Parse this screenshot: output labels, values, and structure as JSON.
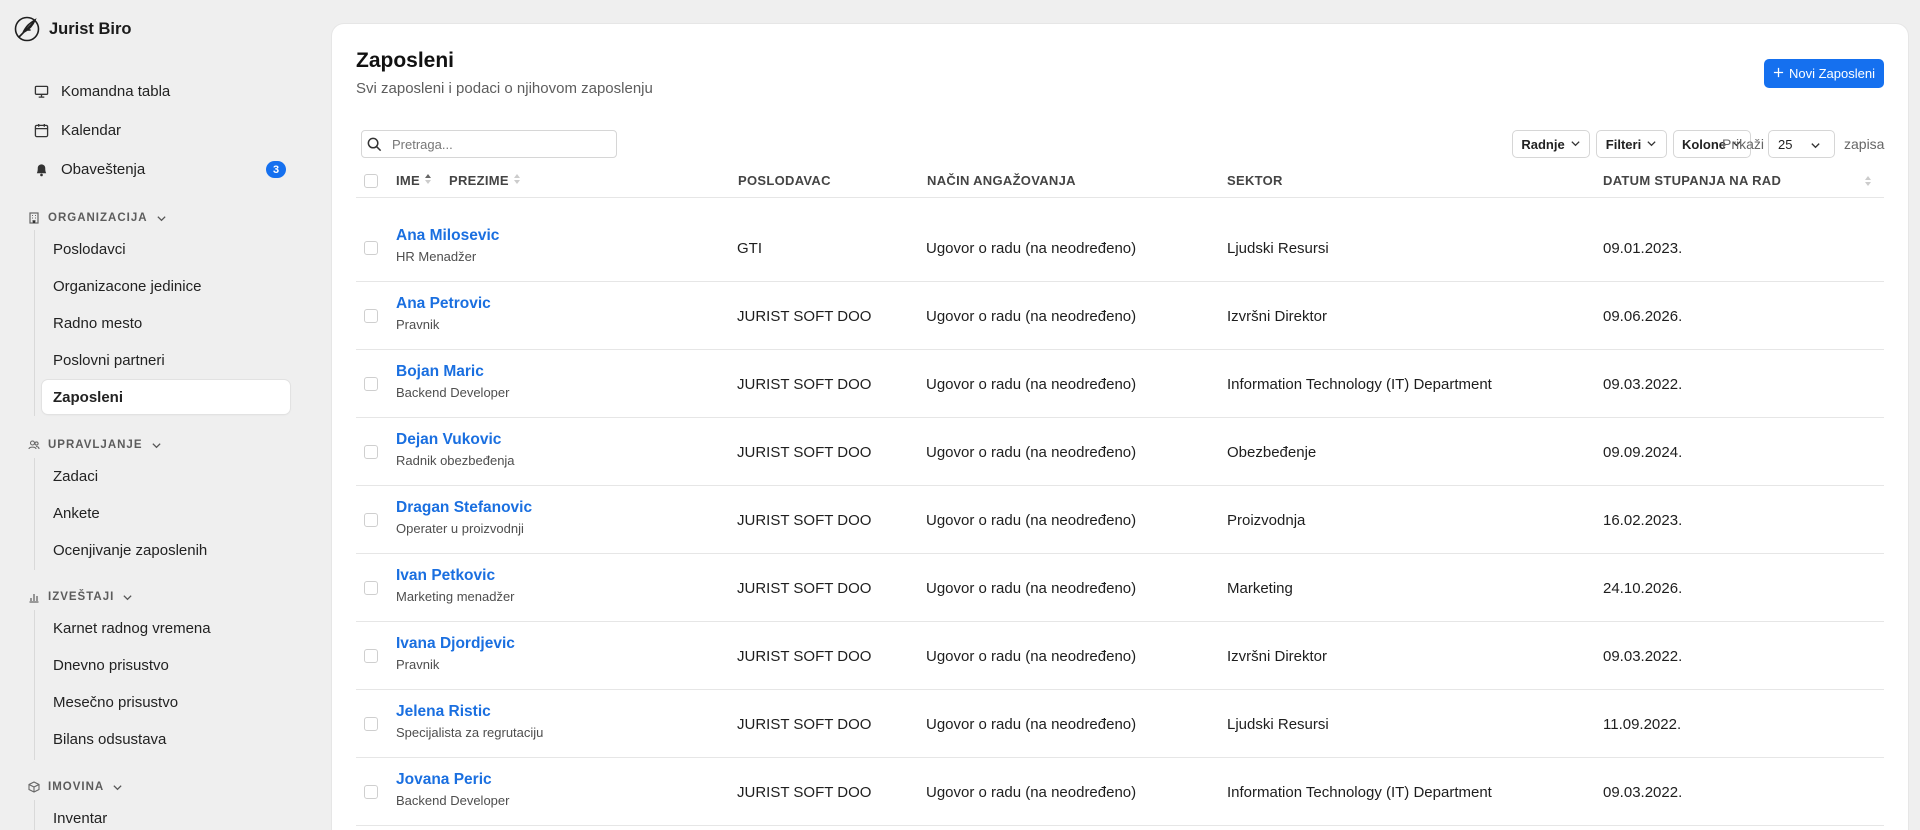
{
  "app": {
    "name": "Jurist Biro"
  },
  "nav": {
    "top_items": [
      {
        "label": "Komandna tabla",
        "icon": "monitor-icon"
      },
      {
        "label": "Kalendar",
        "icon": "calendar-icon"
      },
      {
        "label": "Obaveštenja",
        "icon": "bell-icon",
        "badge": "3"
      }
    ],
    "sections": [
      {
        "label": "ORGANIZACIJA",
        "icon": "building-icon",
        "items": [
          "Poslodavci",
          "Organizacone jedinice",
          "Radno mesto",
          "Poslovni partneri",
          "Zaposleni"
        ]
      },
      {
        "label": "UPRAVLJANJE",
        "icon": "users-icon",
        "items": [
          "Zadaci",
          "Ankete",
          "Ocenjivanje zaposlenih"
        ]
      },
      {
        "label": "IZVEŠTAJI",
        "icon": "bar-chart-icon",
        "items": [
          "Karnet radnog vremena",
          "Dnevno prisustvo",
          "Mesečno prisustvo",
          "Bilans odsustava"
        ]
      },
      {
        "label": "IMOVINA",
        "icon": "box-icon",
        "items": [
          "Inventar"
        ]
      }
    ],
    "active_item": "Zaposleni"
  },
  "page": {
    "title": "Zaposleni",
    "subtitle": "Svi zaposleni i podaci o njihovom zaposlenju",
    "new_button_label": "Novi Zaposleni"
  },
  "toolbar": {
    "search_placeholder": "Pretraga...",
    "actions_label": "Radnje",
    "filters_label": "Filteri",
    "columns_label": "Kolone",
    "show_label": "Prikaži",
    "page_size": "25",
    "records_label": "zapisa"
  },
  "table": {
    "columns": {
      "first_name": "IME",
      "last_name": "PREZIME",
      "employer": "POSLODAVAC",
      "engagement": "NAČIN ANGAŽOVANJA",
      "sector": "SEKTOR",
      "start_date": "DATUM STUPANJA NA RAD"
    },
    "rows": [
      {
        "name": "Ana Milosevic",
        "title": "HR Menadžer",
        "employer": "GTI",
        "engagement": "Ugovor o radu (na neodređeno)",
        "sector": "Ljudski Resursi",
        "start_date": "09.01.2023."
      },
      {
        "name": "Ana Petrovic",
        "title": "Pravnik",
        "employer": "JURIST SOFT DOO",
        "engagement": "Ugovor o radu (na neodređeno)",
        "sector": "Izvršni Direktor",
        "start_date": "09.06.2026."
      },
      {
        "name": "Bojan Maric",
        "title": "Backend Developer",
        "employer": "JURIST SOFT DOO",
        "engagement": "Ugovor o radu (na neodređeno)",
        "sector": "Information Technology (IT) Department",
        "start_date": "09.03.2022."
      },
      {
        "name": "Dejan Vukovic",
        "title": "Radnik obezbeđenja",
        "employer": "JURIST SOFT DOO",
        "engagement": "Ugovor o radu (na neodređeno)",
        "sector": "Obezbeđenje",
        "start_date": "09.09.2024."
      },
      {
        "name": "Dragan Stefanovic",
        "title": "Operater u proizvodnji",
        "employer": "JURIST SOFT DOO",
        "engagement": "Ugovor o radu (na neodređeno)",
        "sector": "Proizvodnja",
        "start_date": "16.02.2023."
      },
      {
        "name": "Ivan Petkovic",
        "title": "Marketing menadžer",
        "employer": "JURIST SOFT DOO",
        "engagement": "Ugovor o radu (na neodređeno)",
        "sector": "Marketing",
        "start_date": "24.10.2026."
      },
      {
        "name": "Ivana Djordjevic",
        "title": "Pravnik",
        "employer": "JURIST SOFT DOO",
        "engagement": "Ugovor o radu (na neodređeno)",
        "sector": "Izvršni Direktor",
        "start_date": "09.03.2022."
      },
      {
        "name": "Jelena Ristic",
        "title": "Specijalista za regrutaciju",
        "employer": "JURIST SOFT DOO",
        "engagement": "Ugovor o radu (na neodređeno)",
        "sector": "Ljudski Resursi",
        "start_date": "11.09.2022."
      },
      {
        "name": "Jovana Peric",
        "title": "Backend Developer",
        "employer": "JURIST SOFT DOO",
        "engagement": "Ugovor o radu (na neodređeno)",
        "sector": "Information Technology (IT) Department",
        "start_date": "09.03.2022."
      }
    ]
  },
  "colors": {
    "accent": "#1570ef",
    "link": "#1a6fe0",
    "background": "#efefef",
    "card": "#ffffff"
  }
}
